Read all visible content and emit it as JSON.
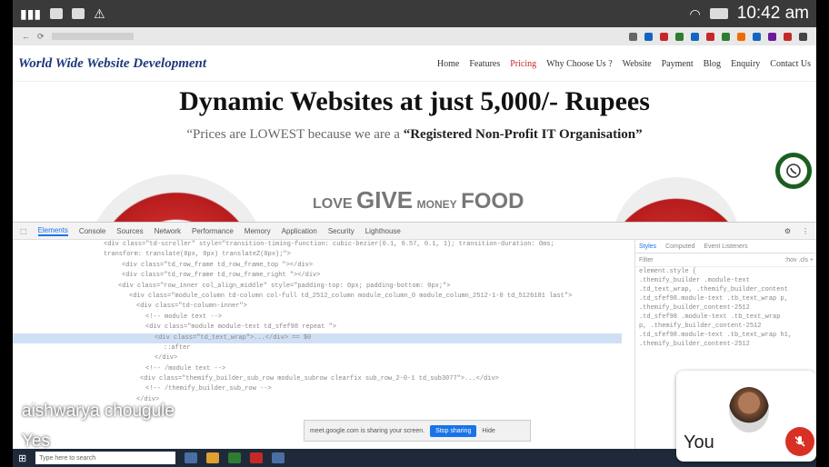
{
  "status_bar": {
    "clock": "10:42 am"
  },
  "site": {
    "logo": "World Wide Website Development",
    "nav": [
      "Home",
      "Features",
      "Pricing",
      "Why Choose Us ?",
      "Website",
      "Payment",
      "Blog",
      "Enquiry",
      "Contact Us"
    ],
    "active_nav": "Pricing",
    "hero_title": "Dynamic Websites at just 5,000/- Rupees",
    "hero_sub_quote": "“Prices are LOWEST because we are a ",
    "hero_sub_bold": "“Registered Non-Profit IT Organisation”",
    "wordcloud": [
      "LOVE",
      "GIVE",
      "MONEY",
      "FOOD"
    ]
  },
  "devtools": {
    "tabs": [
      "Elements",
      "Console",
      "Sources",
      "Network",
      "Performance",
      "Memory",
      "Application",
      "Security",
      "Lighthouse"
    ],
    "selected_tab": "Elements",
    "styles_tabs": [
      "Styles",
      "Computed",
      "Event Listeners"
    ],
    "styles_filter": "Filter",
    "styles_filter_right": ":hov .cls +",
    "element_style": "element.style {",
    "code_lines": [
      "<div class=\"td-scroller\" style=\"transition-timing-function: cubic-bezier(0.1, 0.57, 0.1, 1); transition-duration: 0ms;",
      "transform: translate(0px, 0px) translateZ(0px);\">",
      "<div class=\"td_row_frame td_row_frame_top \"></div>",
      "<div class=\"td_row_frame td_row_frame_right \"></div>",
      "<div class=\"row_inner col_align_middle\" style=\"padding-top: 0px; padding-bottom: 0px;\">",
      "<div class=\"module_column td-column col-full td_2512_column module_column_0 module_column_2512-1-0 td_5126181 last\">",
      "<div class=\"td-column-inner\">",
      "<!-- module text -->",
      "<div class=\"module module-text td_sfef98 repeat \">",
      "<div class=\"td_text_wrap\">...</div> == $0",
      "::after",
      "</div>",
      "<!-- /module text -->",
      "<div class=\"themify_builder_sub_row module_subrow clearfix sub_row_2-0-1 td_sub3077\">...</div>",
      "<!-- /themify_builder_sub_row -->",
      "</div>"
    ],
    "styles_lines": [
      ".themify_builder .module-text",
      ".td_text_wrap, .themify_builder_content",
      ".td_sfef98.module-text .tb_text_wrap p,",
      ".themify_builder_content-2512",
      ".td_sfef98 .module-text .tb_text_wrap",
      "p, .themify_builder_content-2512",
      ".td_sfef98.module-text .tb_text_wrap h1,",
      ".themify_builder_content-2512"
    ]
  },
  "share_bar": {
    "text": "meet.google.com is sharing your screen.",
    "stop": "Stop sharing",
    "hide": "Hide"
  },
  "taskbar": {
    "search": "Type here to search"
  },
  "meet": {
    "speaker_name": "aishwarya chougule",
    "caption": "Yes",
    "self_label": "You",
    "accent": "#d93025"
  }
}
